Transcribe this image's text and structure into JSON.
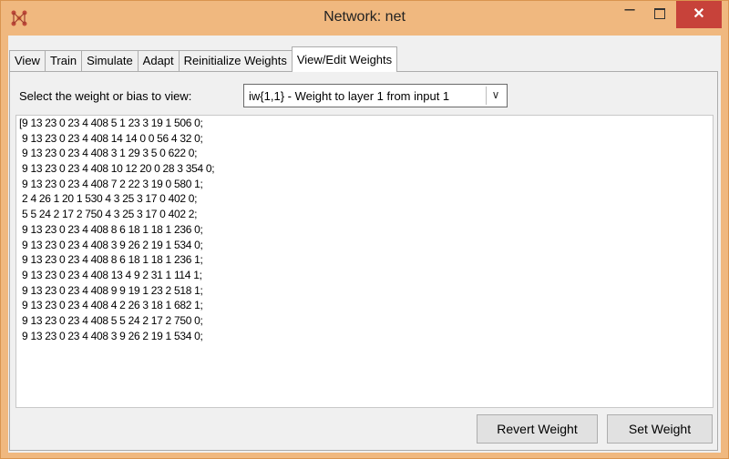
{
  "window": {
    "title": "Network: net",
    "controls": {
      "minimize": "–",
      "maximize": "",
      "close": "✕"
    },
    "colors": {
      "frame": "#f0b87f",
      "close": "#c7423a"
    }
  },
  "tabs": [
    {
      "label": "View"
    },
    {
      "label": "Train"
    },
    {
      "label": "Simulate"
    },
    {
      "label": "Adapt"
    },
    {
      "label": "Reinitialize Weights"
    },
    {
      "label": "View/Edit Weights"
    }
  ],
  "selector": {
    "label": "Select the weight or bias to view:",
    "value": "iw{1,1} - Weight to layer 1 from input 1"
  },
  "weights_text": [
    "[9 13 23 0 23 4 408 5 1 23 3 19 1 506 0;",
    " 9 13 23 0 23 4 408 14 14 0 0 56 4 32 0;",
    " 9 13 23 0 23 4 408 3 1 29 3 5 0 622 0;",
    " 9 13 23 0 23 4 408 10 12 20 0 28 3 354 0;",
    " 9 13 23 0 23 4 408 7 2 22 3 19 0 580 1;",
    " 2 4 26 1 20 1 530 4 3 25 3 17 0 402 0;",
    " 5 5 24 2 17 2 750 4 3 25 3 17 0 402 2;",
    " 9 13 23 0 23 4 408 8 6 18 1 18 1 236 0;",
    " 9 13 23 0 23 4 408 3 9 26 2 19 1 534 0;",
    " 9 13 23 0 23 4 408 8 6 18 1 18 1 236 1;",
    " 9 13 23 0 23 4 408 13 4 9 2 31 1 114 1;",
    " 9 13 23 0 23 4 408 9 9 19 1 23 2 518 1;",
    " 9 13 23 0 23 4 408 4 2 26 3 18 1 682 1;",
    " 9 13 23 0 23 4 408 5 5 24 2 17 2 750 0;",
    " 9 13 23 0 23 4 408 3 9 26 2 19 1 534 0;"
  ],
  "buttons": {
    "revert": "Revert Weight",
    "set": "Set Weight"
  }
}
